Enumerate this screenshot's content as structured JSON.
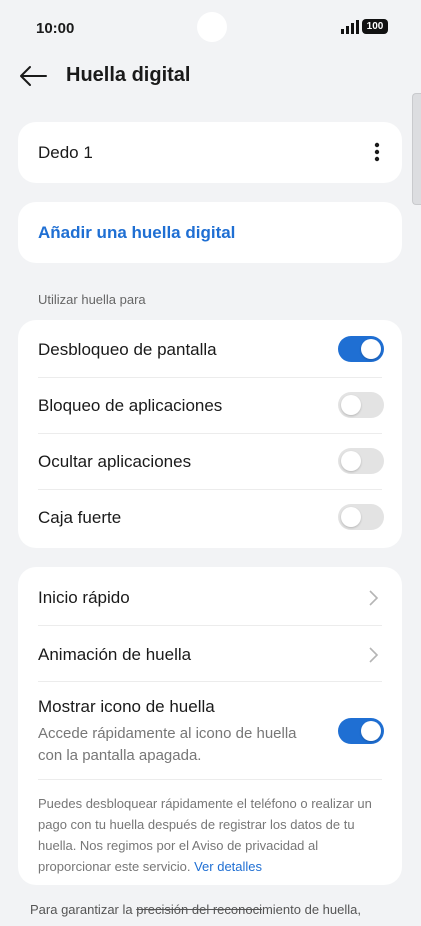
{
  "status": {
    "time": "10:00",
    "battery": "100"
  },
  "header": {
    "title": "Huella digital"
  },
  "fingers": {
    "finger1": "Dedo 1"
  },
  "add": {
    "label": "Añadir una huella digital"
  },
  "section": {
    "use_for": "Utilizar huella para"
  },
  "toggles": [
    {
      "label": "Desbloqueo de pantalla",
      "on": true
    },
    {
      "label": "Bloqueo de aplicaciones",
      "on": false
    },
    {
      "label": "Ocultar aplicaciones",
      "on": false
    },
    {
      "label": "Caja fuerte",
      "on": false
    }
  ],
  "settings": {
    "quick_start": "Inicio rápido",
    "animation": "Animación de huella",
    "show_icon": "Mostrar icono de huella",
    "show_icon_desc": "Accede rápidamente al icono de huella con la pantalla apagada.",
    "show_icon_on": true,
    "note": "Puedes desbloquear rápidamente el teléfono o realizar un pago con tu huella después de registrar los datos de tu huella. Nos regimos por el Aviso de privacidad al proporcionar este servicio.",
    "note_link": "Ver detalles"
  },
  "footer": {
    "part1": "Para garantizar la ",
    "struck": "precisión del reconoci",
    "part2": "miento de huella,"
  },
  "colors": {
    "accent": "#1f6fd3",
    "background": "#f2f3f5"
  }
}
